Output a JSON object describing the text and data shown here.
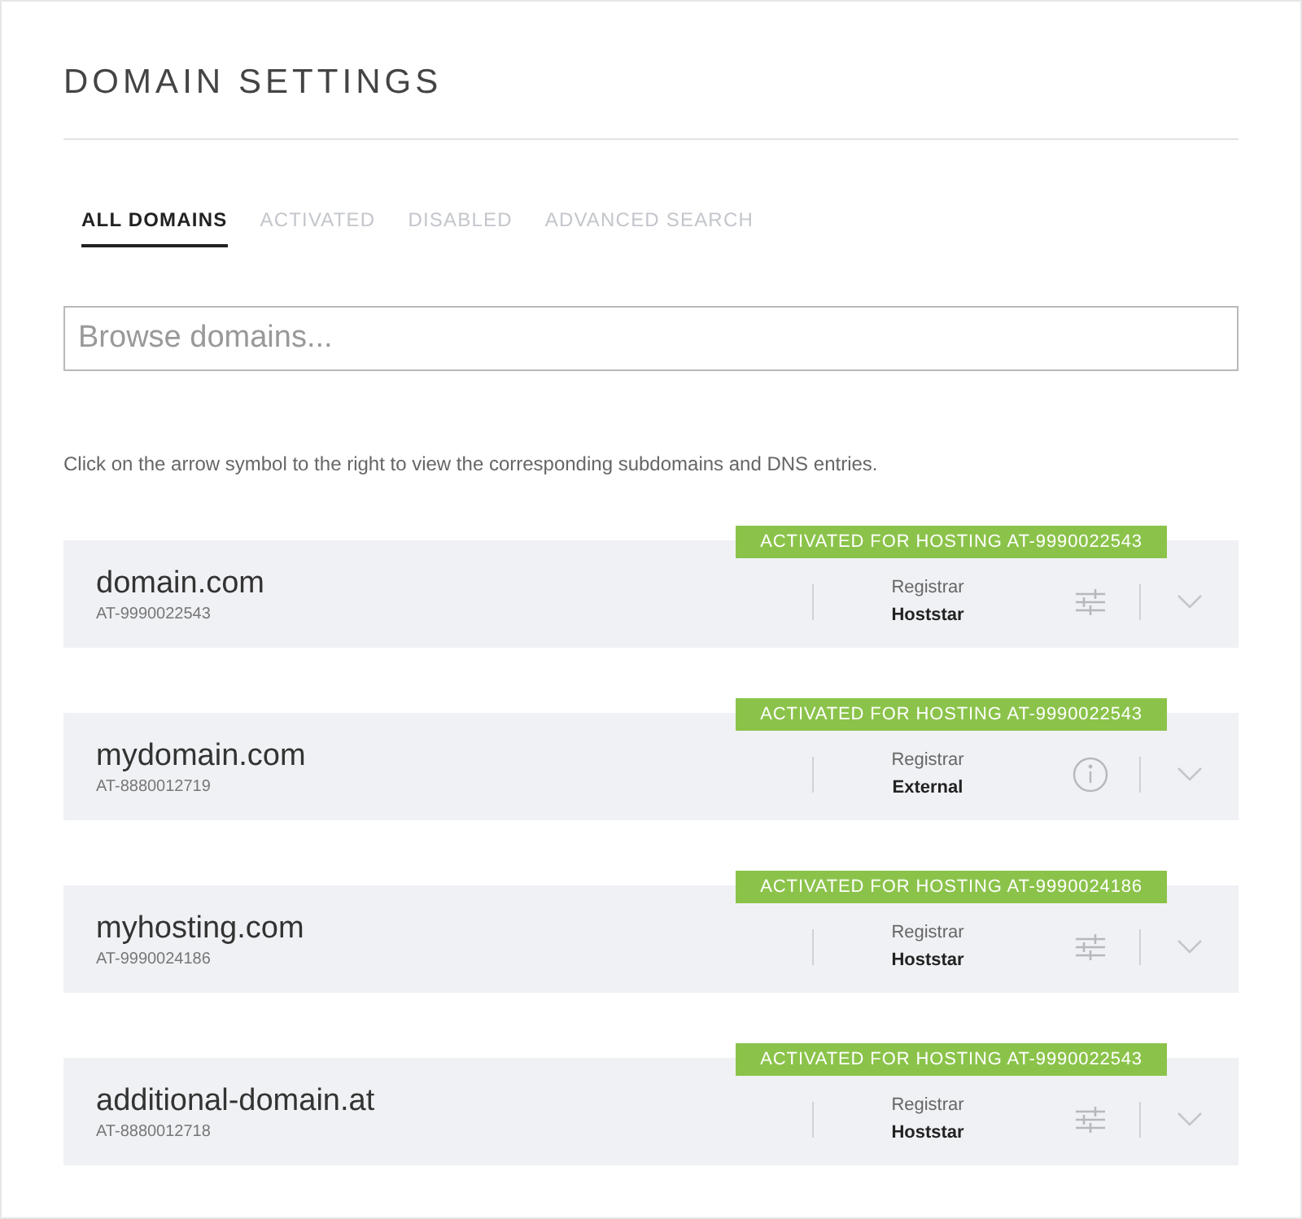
{
  "title": "DOMAIN SETTINGS",
  "tabs": [
    {
      "label": "ALL DOMAINS",
      "selected": true
    },
    {
      "label": "ACTIVATED",
      "selected": false
    },
    {
      "label": "DISABLED",
      "selected": false
    },
    {
      "label": "ADVANCED SEARCH",
      "selected": false
    }
  ],
  "search": {
    "placeholder": "Browse domains..."
  },
  "hint": "Click on the arrow symbol to the right to view the corresponding subdomains and DNS entries.",
  "domains": [
    {
      "name": "domain.com",
      "id": "AT-9990022543",
      "badge": "ACTIVATED FOR HOSTING AT-9990022543",
      "registrar_label": "Registrar",
      "registrar": "Hoststar",
      "kind": "settings"
    },
    {
      "name": "mydomain.com",
      "id": "AT-8880012719",
      "badge": "ACTIVATED FOR HOSTING AT-9990022543",
      "registrar_label": "Registrar",
      "registrar": "External",
      "kind": "info"
    },
    {
      "name": "myhosting.com",
      "id": "AT-9990024186",
      "badge": "ACTIVATED FOR HOSTING AT-9990024186",
      "registrar_label": "Registrar",
      "registrar": "Hoststar",
      "kind": "settings"
    },
    {
      "name": "additional-domain.at",
      "id": "AT-8880012718",
      "badge": "ACTIVATED FOR HOSTING AT-9990022543",
      "registrar_label": "Registrar",
      "registrar": "Hoststar",
      "kind": "settings"
    }
  ]
}
